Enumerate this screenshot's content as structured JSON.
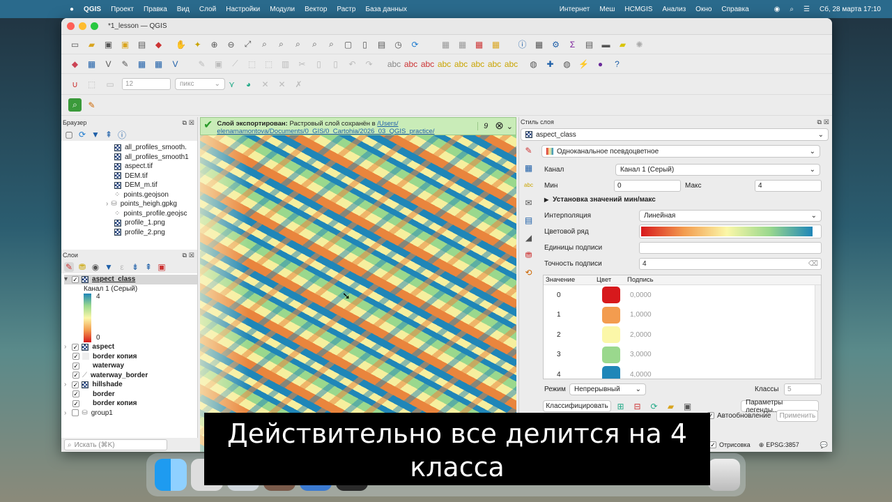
{
  "menubar": {
    "app": "QGIS",
    "items": [
      "Проект",
      "Правка",
      "Вид",
      "Слой",
      "Настройки",
      "Модули",
      "Вектор",
      "Растр",
      "База данных",
      "Интернет",
      "Меш",
      "HCMGIS",
      "Анализ",
      "Окно",
      "Справка"
    ],
    "datetime": "Сб, 28 марта  17:10"
  },
  "window": {
    "title": "*1_lesson — QGIS"
  },
  "toolbar": {
    "size_value": "12",
    "size_unit": "пикс"
  },
  "message": {
    "bold": "Слой экспортирован:",
    "text": "Растровый слой сохранён в",
    "link": "/Users/",
    "path": "elenamamontova/Documents/0_GIS/0_Cartohia/2026_03_QGIS_practice/",
    "count": "9"
  },
  "browser": {
    "title": "Браузер",
    "items": [
      {
        "name": "all_profiles_smooth.",
        "type": "raster"
      },
      {
        "name": "all_profiles_smooth1",
        "type": "raster"
      },
      {
        "name": "aspect.tif",
        "type": "raster"
      },
      {
        "name": "DEM.tif",
        "type": "raster"
      },
      {
        "name": "DEM_m.tif",
        "type": "raster"
      },
      {
        "name": "points.geojson",
        "type": "vector"
      },
      {
        "name": "points_heigh.gpkg",
        "type": "gpkg"
      },
      {
        "name": "points_profile.geojsc",
        "type": "vector"
      },
      {
        "name": "profile_1.png",
        "type": "raster"
      },
      {
        "name": "profile_2.png",
        "type": "raster"
      }
    ]
  },
  "layers": {
    "title": "Слои",
    "active": {
      "name": "aspect_class",
      "band": "Канал 1 (Серый)",
      "max": "4",
      "min": "0"
    },
    "items": [
      {
        "name": "aspect",
        "checked": true,
        "bold": true
      },
      {
        "name": "border копия",
        "checked": true,
        "bold": true
      },
      {
        "name": "waterway",
        "checked": true,
        "bold": true
      },
      {
        "name": "waterway_border",
        "checked": true,
        "bold": true
      },
      {
        "name": "hillshade",
        "checked": true,
        "bold": true
      },
      {
        "name": "border",
        "checked": true,
        "bold": true
      },
      {
        "name": "border копия",
        "checked": true,
        "bold": true
      },
      {
        "name": "group1",
        "checked": false,
        "bold": false
      }
    ]
  },
  "search": {
    "placeholder": "Искать (⌘K)"
  },
  "style": {
    "title": "Стиль слоя",
    "layer": "aspect_class",
    "renderer": "Одноканальное псевдоцветное",
    "band_label": "Канал",
    "band_value": "Канал 1 (Серый)",
    "min_label": "Мин",
    "min_value": "0",
    "max_label": "Макс",
    "max_value": "4",
    "minmax_section": "Установка значений мин/макс",
    "interp_label": "Интерполяция",
    "interp_value": "Линейная",
    "ramp_label": "Цветовой ряд",
    "units_label": "Единицы подписи",
    "precision_label": "Точность подписи",
    "precision_value": "4",
    "col_value": "Значение",
    "col_color": "Цвет",
    "col_label": "Подпись",
    "classes": [
      {
        "value": "0",
        "label": "0,0000",
        "color": "#d7191c"
      },
      {
        "value": "1",
        "label": "1,0000",
        "color": "#f39c4f"
      },
      {
        "value": "2",
        "label": "2,0000",
        "color": "#fbf7a8"
      },
      {
        "value": "3",
        "label": "3,0000",
        "color": "#9ad88d"
      },
      {
        "value": "4",
        "label": "4,0000",
        "color": "#1f86b8"
      }
    ],
    "mode_label": "Режим",
    "mode_value": "Непрерывный",
    "classes_label": "Классы",
    "classes_count": "5",
    "classify_button": "Классифицировать",
    "legend_button": "Параметры легенды...",
    "autoupdate_label": "Автообновление",
    "apply_button": "Применить"
  },
  "statusbar": {
    "render": "Отрисовка",
    "crs": "EPSG:3857"
  },
  "subtitle": "Действительно все делится на 4 класса"
}
